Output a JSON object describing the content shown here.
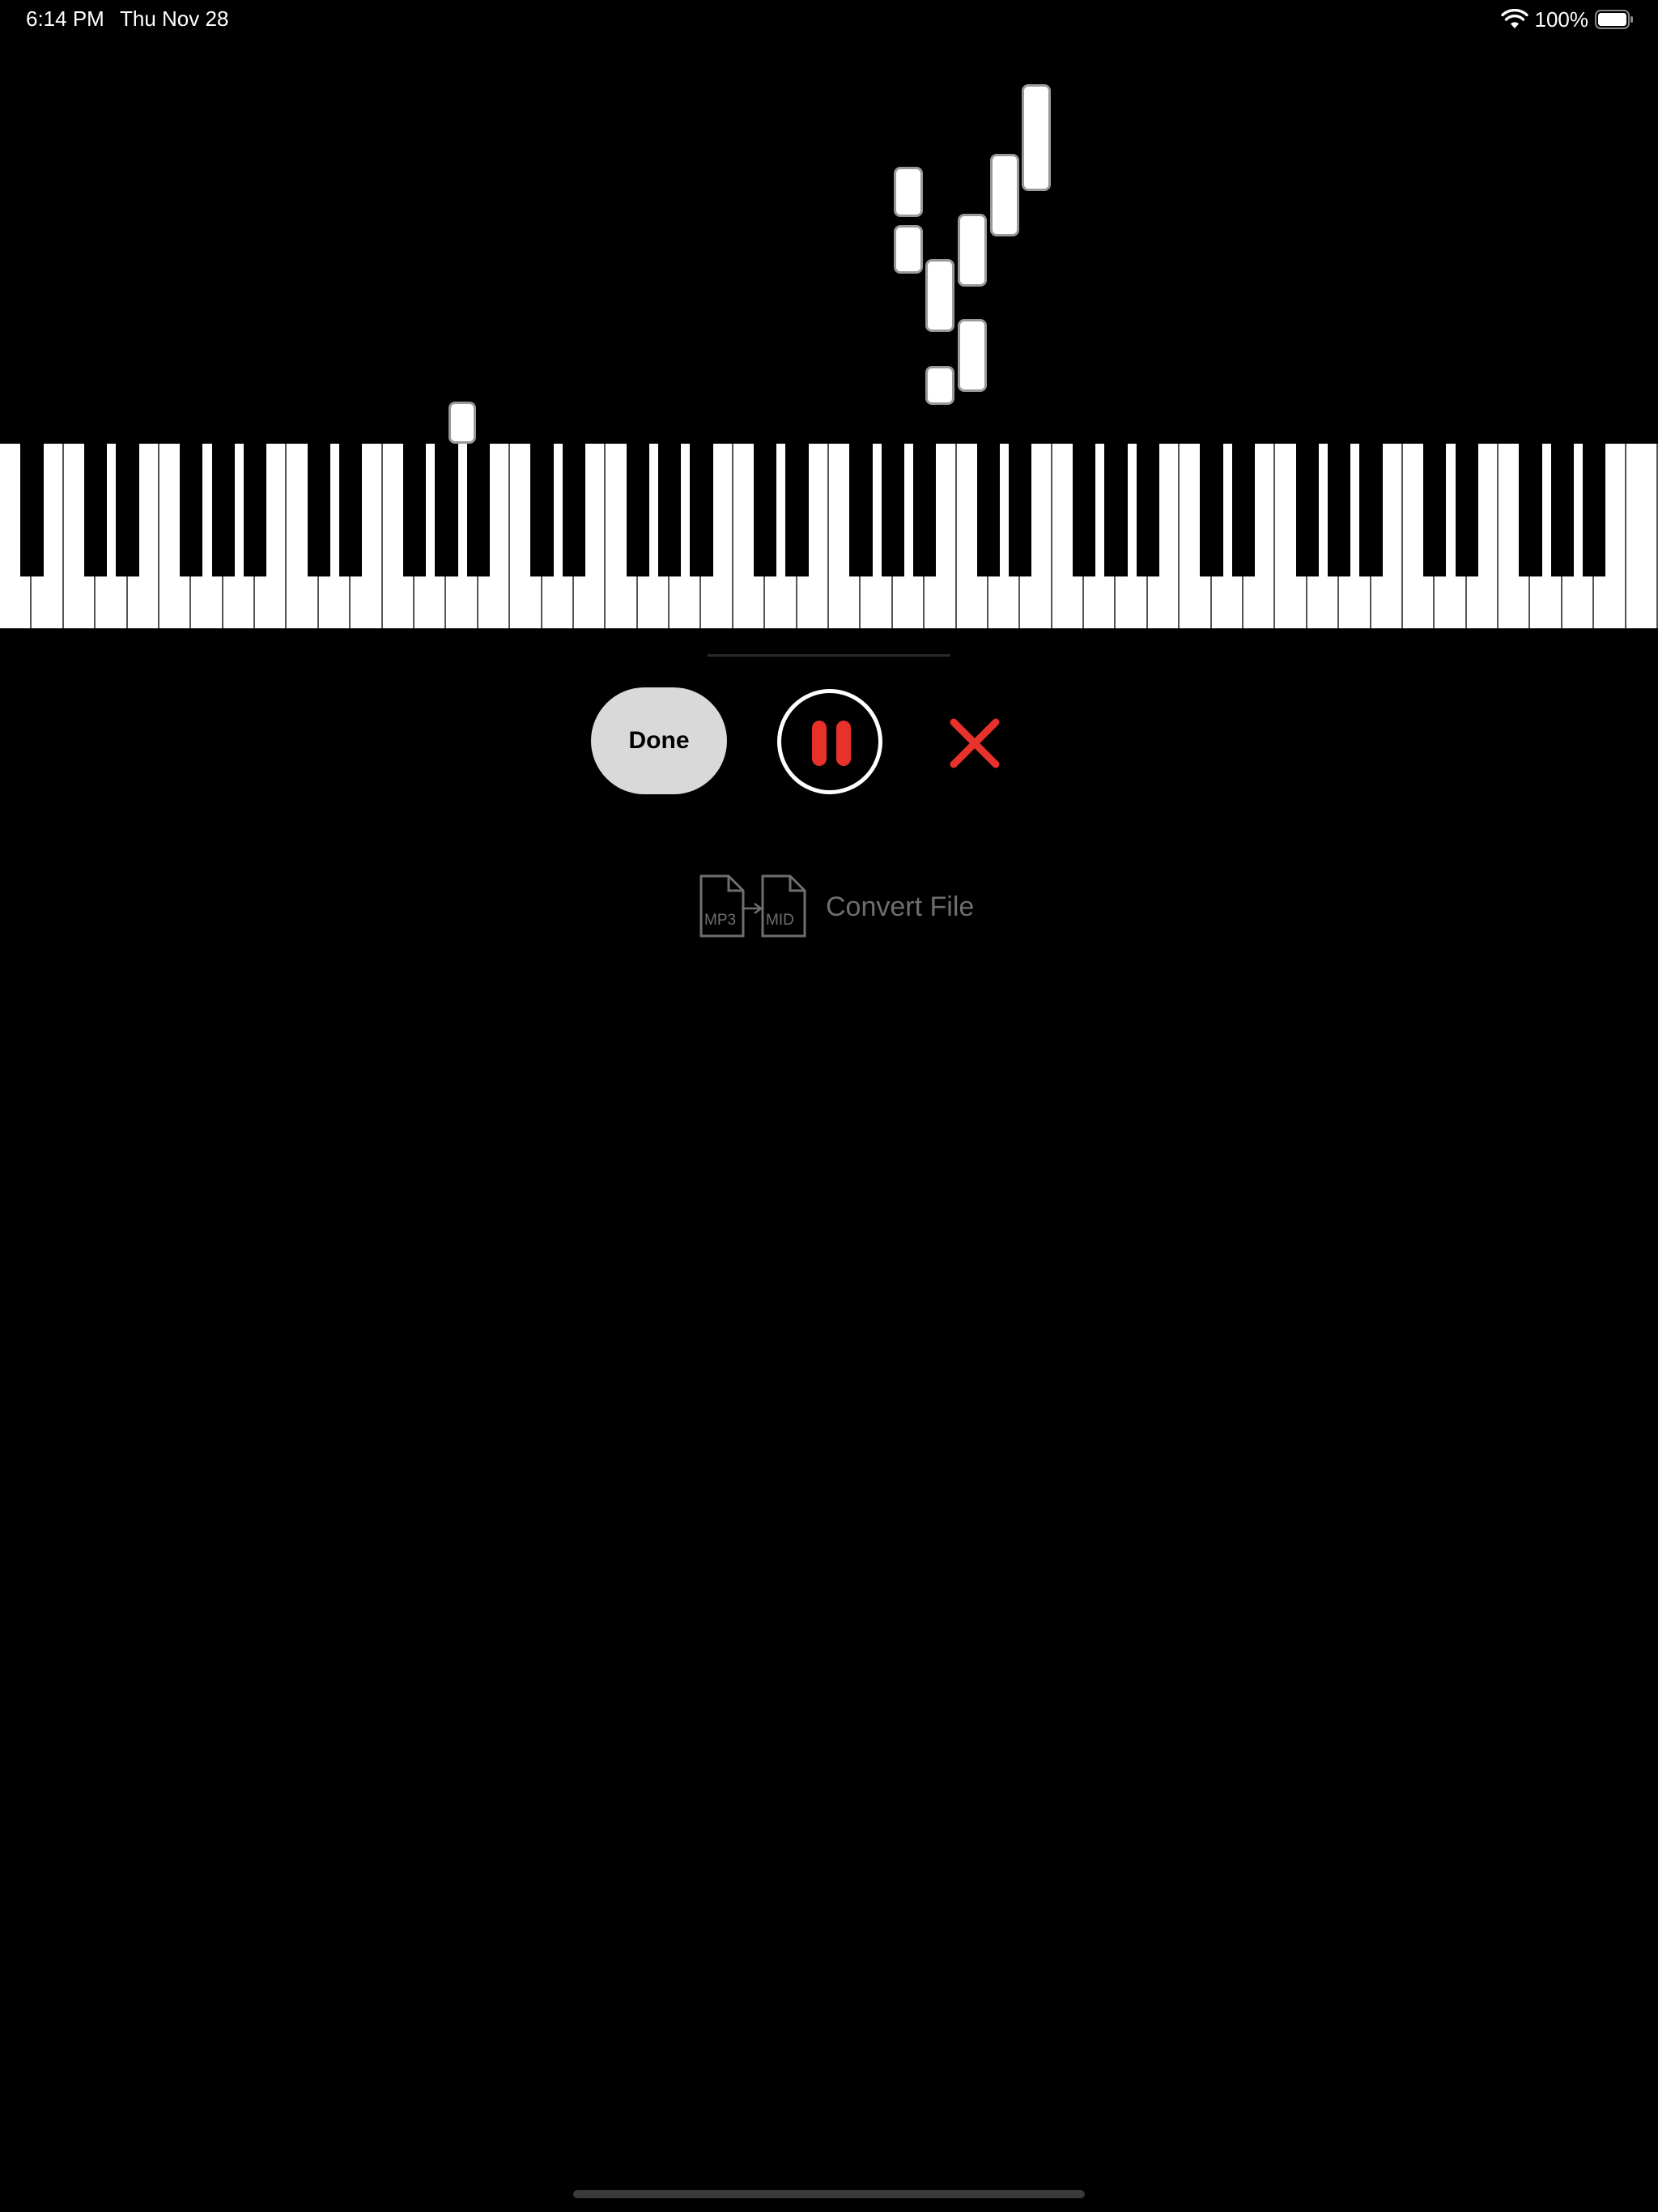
{
  "status_bar": {
    "time": "6:14 PM",
    "date": "Thu Nov 28",
    "battery_percent": "100%",
    "icons": [
      "wifi-icon",
      "battery-icon"
    ]
  },
  "controls": {
    "done_label": "Done",
    "pause_icon": "pause-icon",
    "close_icon": "close-icon",
    "accent_color": "#e8312b"
  },
  "convert": {
    "from_label": "MP3",
    "to_label": "MID",
    "label": "Convert File"
  }
}
